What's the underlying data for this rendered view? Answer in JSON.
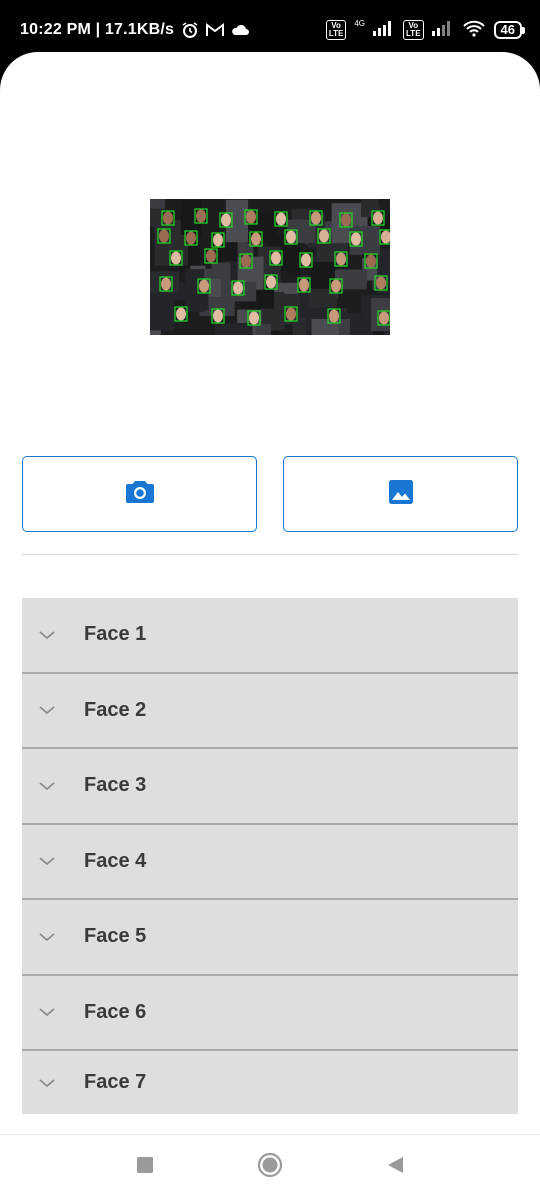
{
  "status_bar": {
    "time_speed": "10:22 PM | 17.1KB/s",
    "network": "4G",
    "volte_label": "Vo\nLTE",
    "battery": "46",
    "icons": [
      "alarm-icon",
      "gmail-icon",
      "cloud-icon",
      "signal-icon",
      "wifi-icon"
    ]
  },
  "preview": {
    "icon": "detected-faces-image",
    "box_color": "#21e021"
  },
  "actions": {
    "camera_icon": "camera-icon",
    "gallery_icon": "image-icon",
    "accent": "#1976d2"
  },
  "faces": [
    {
      "label": "Face 1"
    },
    {
      "label": "Face 2"
    },
    {
      "label": "Face 3"
    },
    {
      "label": "Face 4"
    },
    {
      "label": "Face 5"
    },
    {
      "label": "Face 6"
    },
    {
      "label": "Face 7"
    }
  ],
  "nav": {
    "recents_icon": "square-icon",
    "home_icon": "circle-icon",
    "back_icon": "triangle-back-icon"
  }
}
